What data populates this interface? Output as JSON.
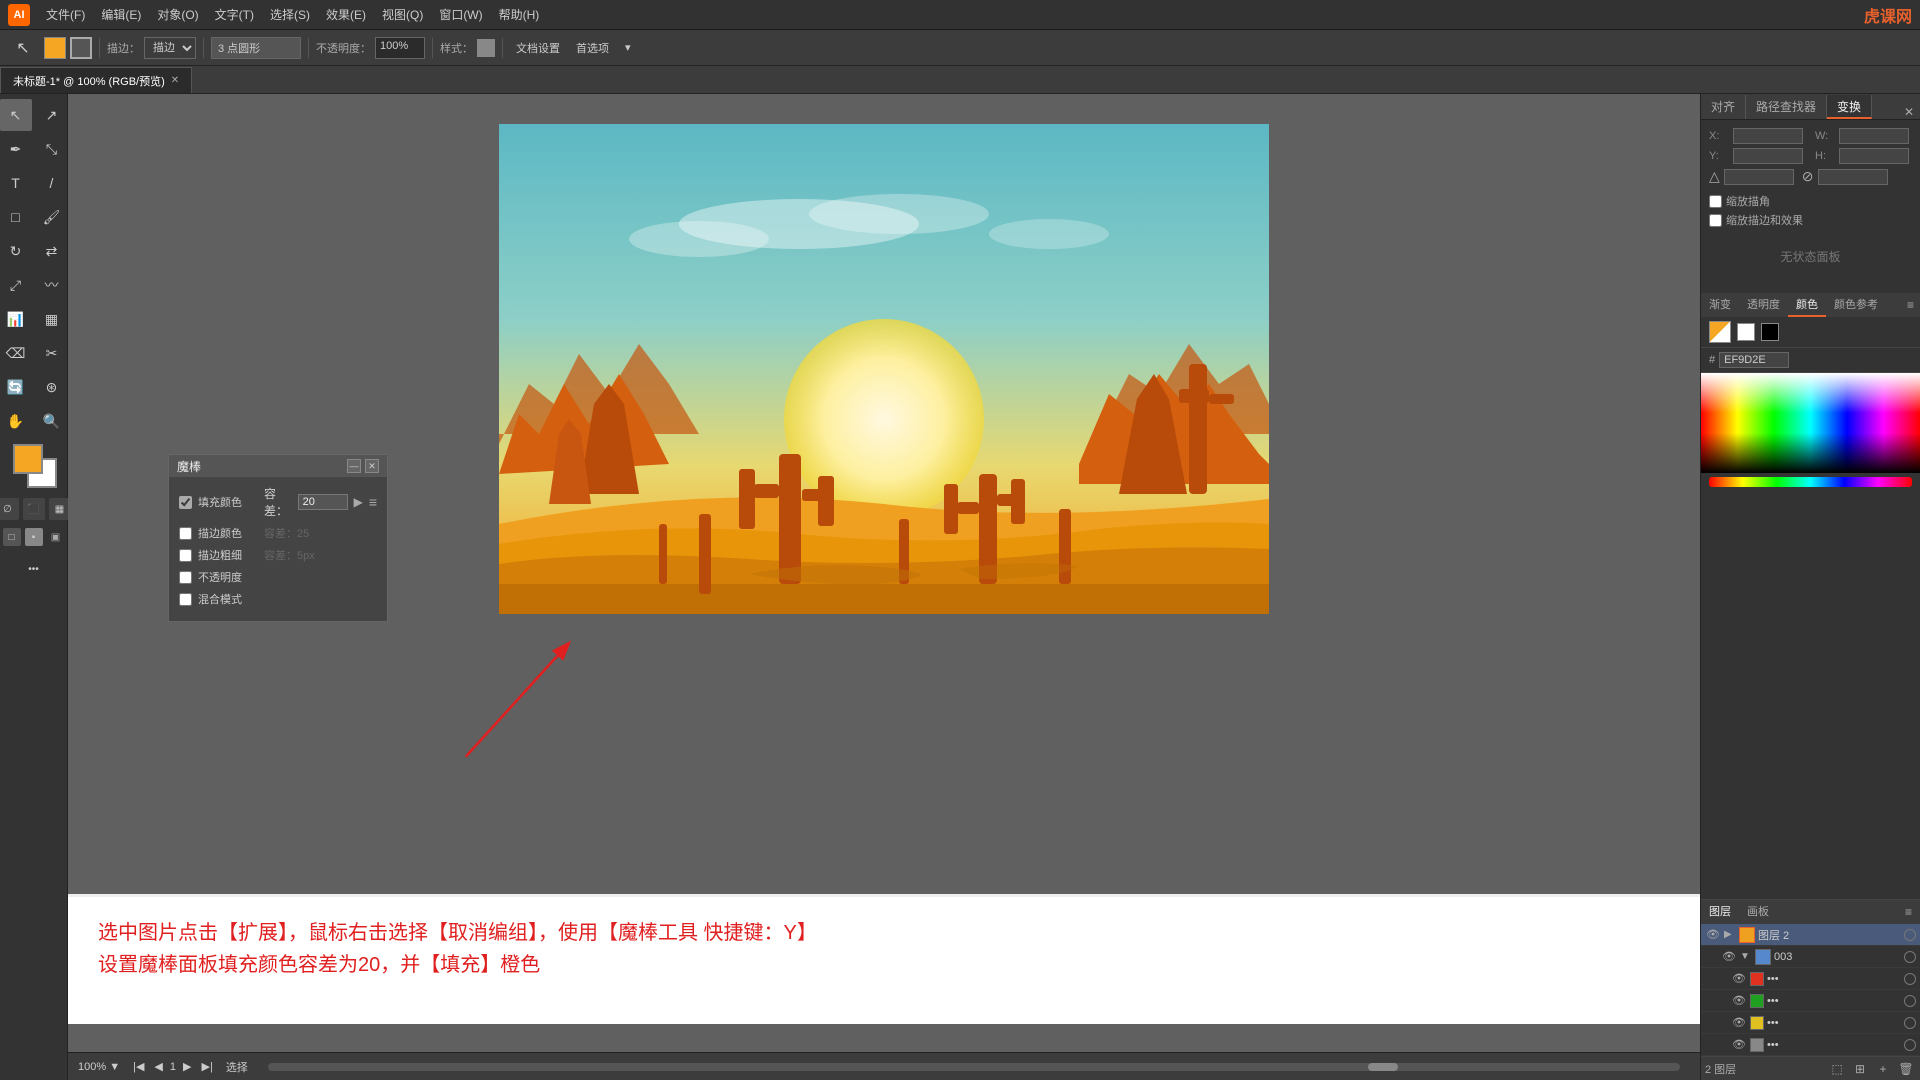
{
  "app": {
    "title": "Adobe Illustrator",
    "icon": "AI",
    "watermark": "虎课网"
  },
  "menu": {
    "items": [
      "文件(F)",
      "编辑(E)",
      "对象(O)",
      "文字(T)",
      "选择(S)",
      "效果(E)",
      "视图(Q)",
      "窗口(W)",
      "帮助(H)"
    ]
  },
  "toolbar": {
    "color_fill": "#f5a623",
    "stroke_color": "#888888",
    "brush_label": "描边：",
    "point_type": "3 点圆形",
    "opacity_label": "不透明度：",
    "opacity_value": "100%",
    "style_label": "样式：",
    "doc_settings": "文档设置",
    "preferences": "首选项"
  },
  "tabs": {
    "active": "未标题-1* @ 100% (RGB/预览)"
  },
  "magic_wand_panel": {
    "title": "魔棒",
    "fill_color_label": "填充颜色",
    "fill_color_checked": true,
    "tolerance_label": "容差：",
    "tolerance_value": "20",
    "stroke_color_label": "描边颜色",
    "stroke_color_checked": false,
    "stroke_weight_label": "描边粗细",
    "stroke_weight_checked": false,
    "opacity_label": "不透明度",
    "opacity_checked": false,
    "blend_mode_label": "混合模式",
    "blend_mode_checked": false
  },
  "right_panel": {
    "tabs": [
      "对齐",
      "路径查找器",
      "变换"
    ],
    "active_tab": "变换",
    "no_selection": "无状态面板",
    "checkboxes": [
      "缩放描角",
      "缩放描边和效果"
    ],
    "color_panel": {
      "tabs": [
        "渐变",
        "透明度",
        "颜色",
        "颜色参考"
      ],
      "active_tab": "颜色",
      "hex_value": "EF9D2E"
    }
  },
  "layers_panel": {
    "tabs": [
      "图层",
      "画板"
    ],
    "active_tab": "图层",
    "layers": [
      {
        "name": "图层 2",
        "visible": true,
        "expanded": true,
        "selected": true
      },
      {
        "name": "003",
        "visible": true,
        "expanded": false
      },
      {
        "name": "...",
        "visible": true,
        "color": "#e03020"
      },
      {
        "name": "...",
        "visible": true,
        "color": "#20a020"
      },
      {
        "name": "...",
        "visible": true,
        "color": "#e0c020"
      },
      {
        "name": "...",
        "visible": true,
        "color": "#888888"
      }
    ],
    "bottom": {
      "layer_count_label": "2 图层"
    }
  },
  "canvas": {
    "zoom": "100%",
    "page": "1",
    "mode": "选择"
  },
  "instruction": {
    "line1": "选中图片点击【扩展】，鼠标右击选择【取消编组】，使用【魔棒工具 快捷键：Y】",
    "line2": "设置魔棒面板填充颜色容差为20，并【填充】橙色"
  }
}
